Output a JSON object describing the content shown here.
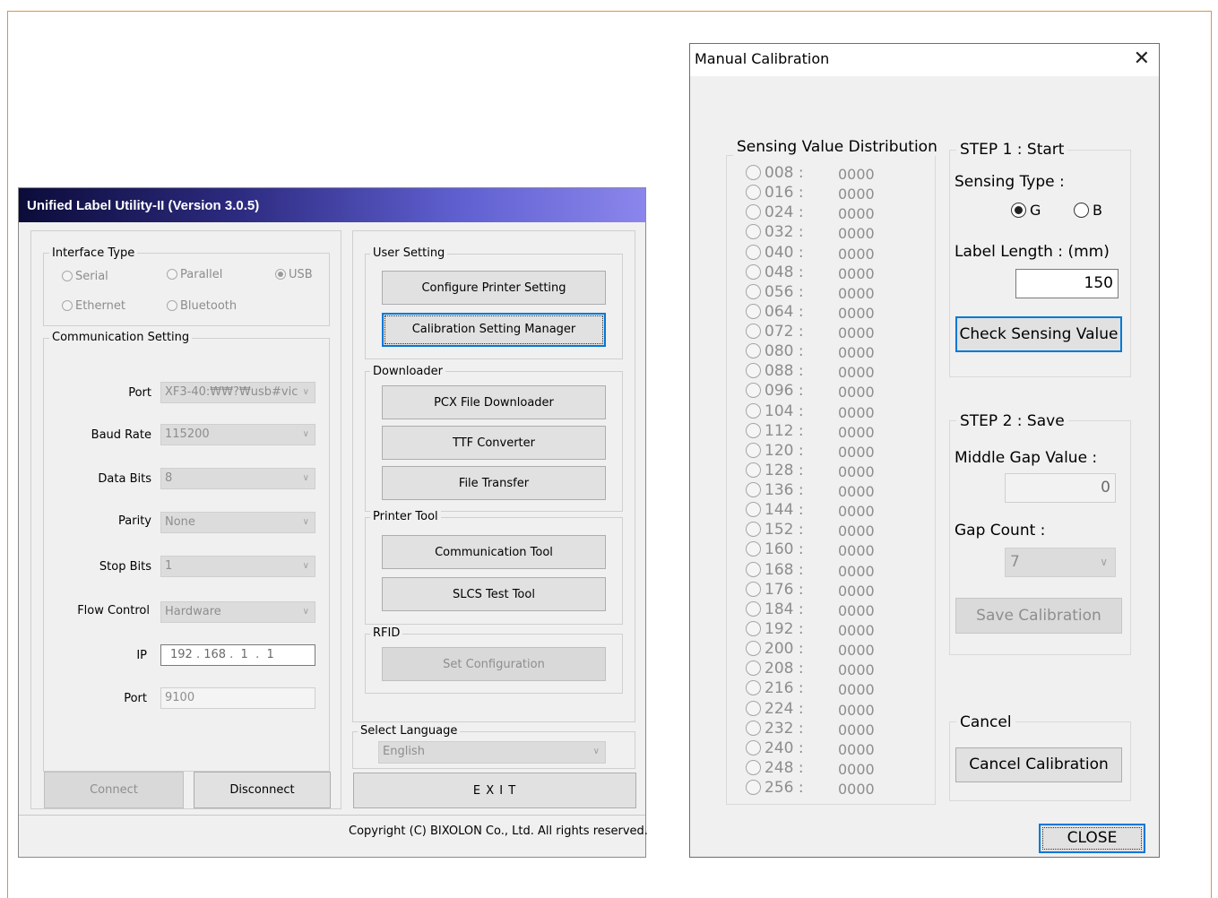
{
  "main_window": {
    "title": "Unified Label Utility-II (Version 3.0.5)",
    "interface_type": {
      "label": "Interface Type",
      "options": [
        "Serial",
        "Parallel",
        "USB",
        "Ethernet",
        "Bluetooth"
      ],
      "selected": "USB"
    },
    "communication": {
      "label": "Communication Setting",
      "port_label": "Port",
      "port_value": "XF3-40:₩₩?₩usb#vic",
      "baud_label": "Baud Rate",
      "baud_value": "115200",
      "databits_label": "Data Bits",
      "databits_value": "8",
      "parity_label": "Parity",
      "parity_value": "None",
      "stopbits_label": "Stop Bits",
      "stopbits_value": "1",
      "flow_label": "Flow Control",
      "flow_value": "Hardware",
      "ip_label": "IP",
      "ip_value": "192 . 168 .  1  .  1",
      "tcp_port_label": "Port",
      "tcp_port_value": "9100"
    },
    "connect_label": "Connect",
    "disconnect_label": "Disconnect",
    "user_setting": {
      "label": "User Setting",
      "configure": "Configure Printer Setting",
      "calibration": "Calibration Setting Manager"
    },
    "downloader": {
      "label": "Downloader",
      "pcx": "PCX File Downloader",
      "ttf": "TTF Converter",
      "transfer": "File Transfer"
    },
    "printer_tool": {
      "label": "Printer Tool",
      "comm": "Communication Tool",
      "slcs": "SLCS Test Tool"
    },
    "rfid": {
      "label": "RFID",
      "set_config": "Set Configuration"
    },
    "language": {
      "label": "Select Language",
      "value": "English"
    },
    "exit_label": "E X I T",
    "copyright": "Copyright (C) BIXOLON Co., Ltd. All rights reserved."
  },
  "calibration": {
    "title": "Manual Calibration",
    "close_x": "✕",
    "distribution_label": "Sensing Value Distribution",
    "rows": [
      {
        "label": "008 :",
        "value": "0000"
      },
      {
        "label": "016 :",
        "value": "0000"
      },
      {
        "label": "024 :",
        "value": "0000"
      },
      {
        "label": "032 :",
        "value": "0000"
      },
      {
        "label": "040 :",
        "value": "0000"
      },
      {
        "label": "048 :",
        "value": "0000"
      },
      {
        "label": "056 :",
        "value": "0000"
      },
      {
        "label": "064 :",
        "value": "0000"
      },
      {
        "label": "072 :",
        "value": "0000"
      },
      {
        "label": "080 :",
        "value": "0000"
      },
      {
        "label": "088 :",
        "value": "0000"
      },
      {
        "label": "096 :",
        "value": "0000"
      },
      {
        "label": "104 :",
        "value": "0000"
      },
      {
        "label": "112 :",
        "value": "0000"
      },
      {
        "label": "120 :",
        "value": "0000"
      },
      {
        "label": "128 :",
        "value": "0000"
      },
      {
        "label": "136 :",
        "value": "0000"
      },
      {
        "label": "144 :",
        "value": "0000"
      },
      {
        "label": "152 :",
        "value": "0000"
      },
      {
        "label": "160 :",
        "value": "0000"
      },
      {
        "label": "168 :",
        "value": "0000"
      },
      {
        "label": "176 :",
        "value": "0000"
      },
      {
        "label": "184 :",
        "value": "0000"
      },
      {
        "label": "192 :",
        "value": "0000"
      },
      {
        "label": "200 :",
        "value": "0000"
      },
      {
        "label": "208 :",
        "value": "0000"
      },
      {
        "label": "216 :",
        "value": "0000"
      },
      {
        "label": "224 :",
        "value": "0000"
      },
      {
        "label": "232 :",
        "value": "0000"
      },
      {
        "label": "240 :",
        "value": "0000"
      },
      {
        "label": "248 :",
        "value": "0000"
      },
      {
        "label": "256 :",
        "value": "0000"
      }
    ],
    "step1": {
      "label": "STEP 1 : Start",
      "sensing_type_label": "Sensing Type :",
      "option_g": "G",
      "option_b": "B",
      "selected": "G",
      "label_length_label": "Label Length : (mm)",
      "label_length_value": "150",
      "check_button": "Check Sensing Value"
    },
    "step2": {
      "label": "STEP 2 : Save",
      "middle_gap_label": "Middle Gap Value :",
      "middle_gap_value": "0",
      "gap_count_label": "Gap Count :",
      "gap_count_value": "7",
      "save_button": "Save Calibration"
    },
    "cancel": {
      "label": "Cancel",
      "button": "Cancel Calibration"
    },
    "close_button": "CLOSE"
  }
}
